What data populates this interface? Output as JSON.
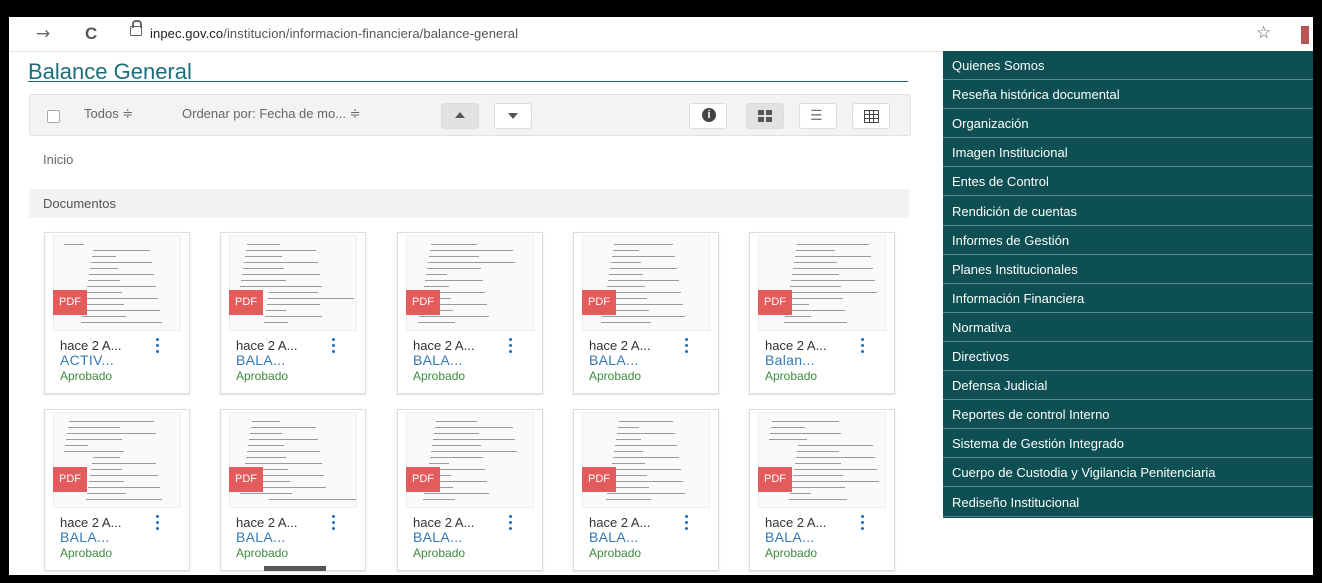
{
  "browser": {
    "back_glyph": "→",
    "reload_glyph": "C",
    "url_domain": "inpec.gov.co",
    "url_path": "/institucion/informacion-financiera/balance-general",
    "star_glyph": "☆"
  },
  "page": {
    "title": "Balance General",
    "breadcrumb": "Inicio",
    "section_title": "Documentos"
  },
  "toolbar": {
    "select_all_label": "Todos ≑",
    "sort_label": "Ordenar por: Fecha de mo... ≑",
    "info_glyph": "i",
    "list_glyph": "☰"
  },
  "documents": [
    {
      "date": "hace 2 A...",
      "name": "ACTIV...",
      "status": "Aprobado",
      "type": "PDF"
    },
    {
      "date": "hace 2 A...",
      "name": "BALA...",
      "status": "Aprobado",
      "type": "PDF"
    },
    {
      "date": "hace 2 A...",
      "name": "BALA...",
      "status": "Aprobado",
      "type": "PDF"
    },
    {
      "date": "hace 2 A...",
      "name": "BALA...",
      "status": "Aprobado",
      "type": "PDF"
    },
    {
      "date": "hace 2 A...",
      "name": "Balan...",
      "status": "Aprobado",
      "type": "PDF"
    },
    {
      "date": "hace 2 A...",
      "name": "BALA...",
      "status": "Aprobado",
      "type": "PDF"
    },
    {
      "date": "hace 2 A...",
      "name": "BALA...",
      "status": "Aprobado",
      "type": "PDF"
    },
    {
      "date": "hace 2 A...",
      "name": "BALA...",
      "status": "Aprobado",
      "type": "PDF"
    },
    {
      "date": "hace 2 A...",
      "name": "BALA...",
      "status": "Aprobado",
      "type": "PDF"
    },
    {
      "date": "hace 2 A...",
      "name": "BALA...",
      "status": "Aprobado",
      "type": "PDF"
    }
  ],
  "menu": [
    "Quienes Somos",
    "Reseña histórica documental",
    "Organización",
    "Imagen Institucional",
    "Entes de Control",
    "Rendición de cuentas",
    "Informes de Gestión",
    "Planes Institucionales",
    "Información Financiera",
    "Normativa",
    "Directivos",
    "Defensa Judicial",
    "Reportes de control Interno",
    "Sistema de Gestión Integrado",
    "Cuerpo de Custodia y Vigilancia Penitenciaria",
    "Rediseño Institucional"
  ],
  "colors": {
    "menu_background": "#0d4f52",
    "title_color": "#1c6f7a",
    "pdf_badge": "#e55b5b",
    "link_blue": "#337ab7",
    "approved_green": "#3c8a3c"
  }
}
